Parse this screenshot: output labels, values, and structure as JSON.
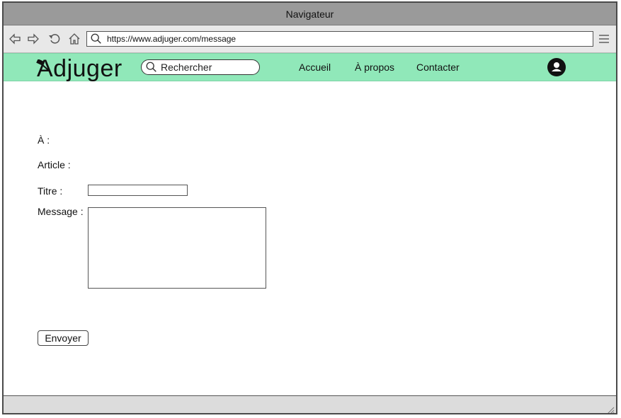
{
  "window": {
    "title": "Navigateur"
  },
  "browser": {
    "url": "https://www.adjuger.com/message",
    "icons": {
      "back": "back-arrow-icon",
      "forward": "forward-arrow-icon",
      "reload": "reload-icon",
      "home": "home-icon",
      "url_search": "search-icon",
      "menu": "hamburger-menu-icon"
    }
  },
  "site_nav": {
    "logo_text": "Adjuger",
    "search_placeholder": "Rechercher",
    "links": [
      "Accueil",
      "À propos",
      "Contacter"
    ],
    "avatar_icon": "user-account-icon",
    "background": "#90e8b9"
  },
  "form": {
    "to_label": "À :",
    "article_label": "Article :",
    "title_label": "Titre :",
    "title_value": "",
    "message_label": "Message :",
    "message_value": "",
    "submit_label": "Envoyer"
  }
}
